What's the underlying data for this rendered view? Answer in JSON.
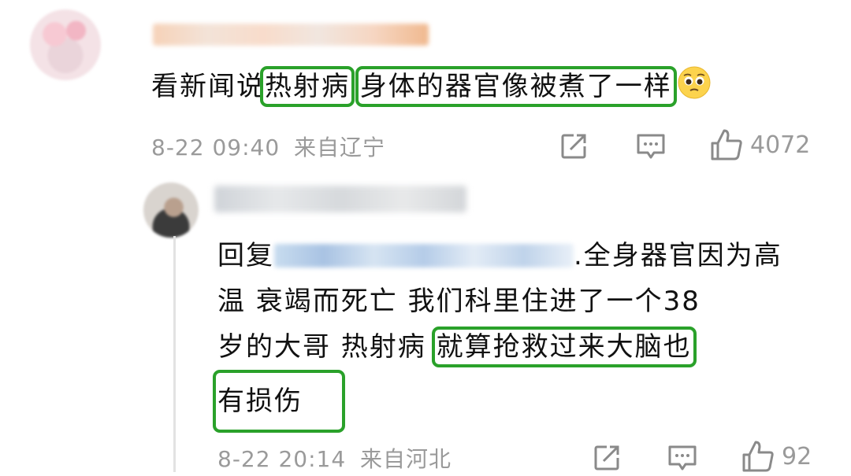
{
  "comment": {
    "text_parts": [
      "看新闻说",
      "热射病",
      " ",
      "身体的器官像被煮了一样"
    ],
    "date": "8-22 09:40",
    "location": "来自辽宁",
    "likes": "4072",
    "emoji": "pleading-face"
  },
  "reply": {
    "prefix": "回复",
    "line1_rest": ".全身器官因为高",
    "line2": "温 衰竭而死亡 我们科里住进了一个38",
    "line3_start": "岁的大哥 热射病 ",
    "highlight1": "就算抢救过来大脑也",
    "highlight2": "有损伤",
    "date": "8-22 20:14",
    "location": "来自河北",
    "likes": "92"
  },
  "icons": [
    "share-icon",
    "comment-icon",
    "like-icon"
  ],
  "colors": {
    "highlight_box": "#2aa12a",
    "meta_text": "#9a9a9a",
    "thread_line": "#e2e2e2"
  }
}
